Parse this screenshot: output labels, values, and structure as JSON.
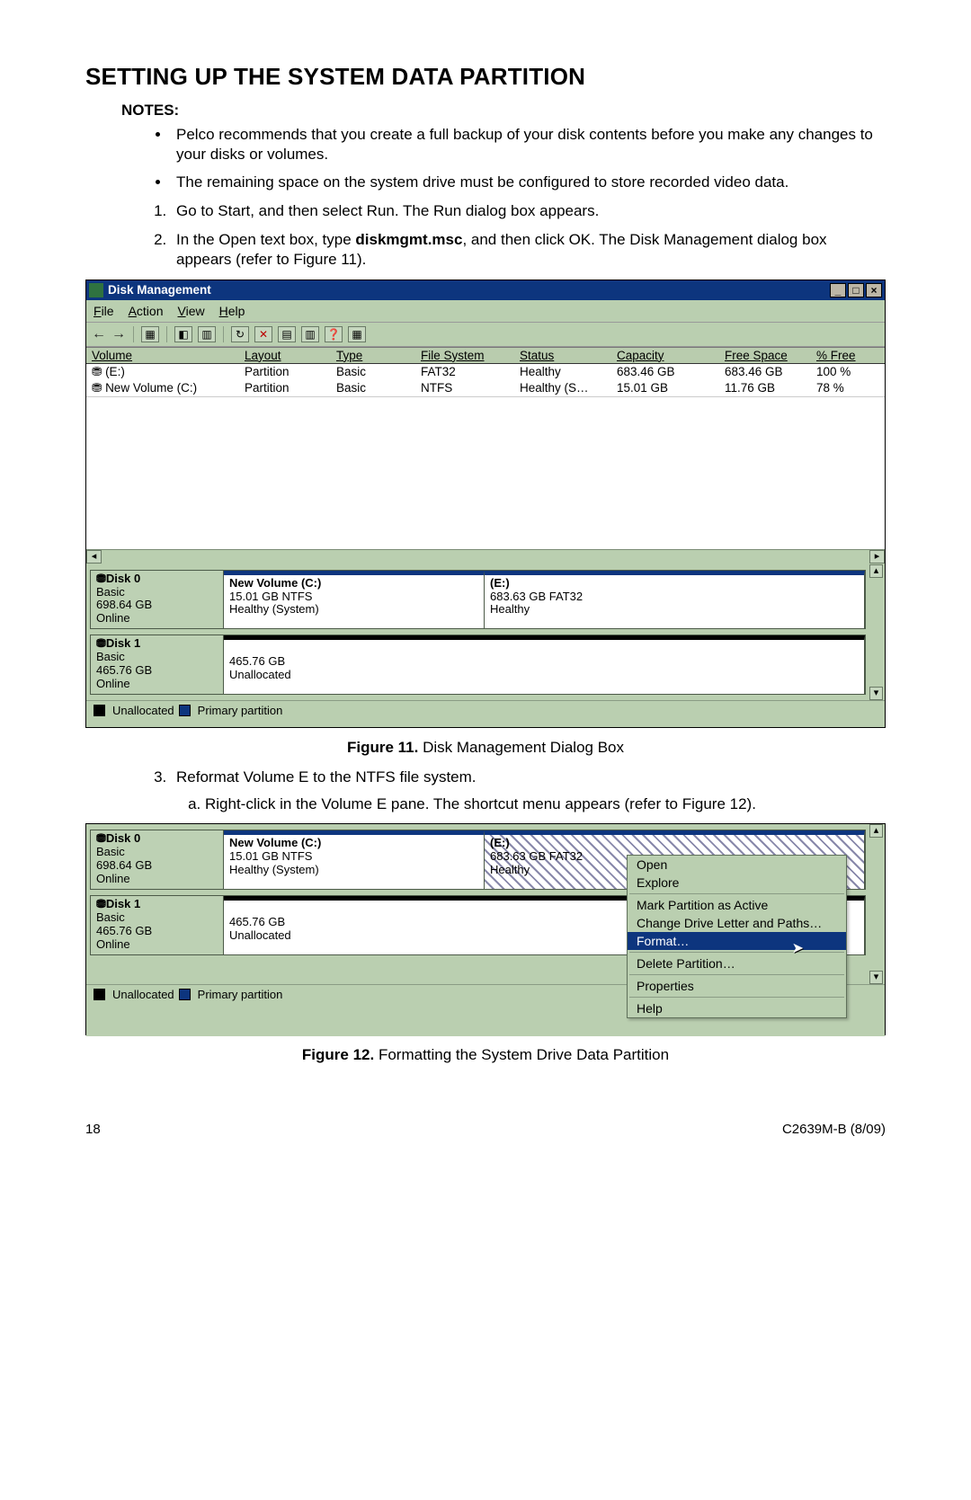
{
  "title": "SETTING UP THE SYSTEM DATA PARTITION",
  "notes_heading": "NOTES:",
  "notes": [
    "Pelco recommends that you create a full backup of your disk contents before you make any changes to your disks or volumes.",
    "The remaining space on the system drive must be configured to store recorded video data."
  ],
  "steps": {
    "s1": "Go to Start, and then select Run. The Run dialog box appears.",
    "s2_a": "In the Open text box, type ",
    "s2_b": "diskmgmt.msc",
    "s2_c": ", and then click OK. The Disk Management dialog box appears (refer to Figure 11).",
    "s3": "Reformat Volume E to the NTFS file system.",
    "s3a": "Right-click in the Volume E pane. The shortcut menu appears (refer to Figure 12)."
  },
  "captions": {
    "fig11_b": "Figure 11.",
    "fig11_t": "  Disk Management Dialog Box",
    "fig12_b": "Figure 12.",
    "fig12_t": "  Formatting the System Drive Data Partition"
  },
  "dm": {
    "title": "Disk Management",
    "menu": {
      "file": "File",
      "action": "Action",
      "view": "View",
      "help": "Help"
    },
    "headers": {
      "volume": "Volume",
      "layout": "Layout",
      "type": "Type",
      "fs": "File System",
      "status": "Status",
      "cap": "Capacity",
      "free": "Free Space",
      "pfree": "% Free"
    },
    "rows": [
      {
        "volume": "(E:)",
        "layout": "Partition",
        "type": "Basic",
        "fs": "FAT32",
        "status": "Healthy",
        "cap": "683.46 GB",
        "free": "683.46 GB",
        "pfree": "100 %"
      },
      {
        "volume": "New Volume (C:)",
        "layout": "Partition",
        "type": "Basic",
        "fs": "NTFS",
        "status": "Healthy (S…",
        "cap": "15.01 GB",
        "free": "11.76 GB",
        "pfree": "78 %"
      }
    ],
    "disk0": {
      "name": "Disk 0",
      "type": "Basic",
      "size": "698.64 GB",
      "state": "Online",
      "p1": {
        "name": "New Volume  (C:)",
        "line2": "15.01 GB NTFS",
        "line3": "Healthy (System)"
      },
      "p2": {
        "name": "(E:)",
        "line2": "683.63 GB FAT32",
        "line3": "Healthy"
      }
    },
    "disk1": {
      "name": "Disk 1",
      "type": "Basic",
      "size": "465.76 GB",
      "state": "Online",
      "p1": {
        "line2": "465.76 GB",
        "line3": "Unallocated"
      }
    },
    "legend": {
      "unalloc": "Unallocated",
      "primary": "Primary partition"
    }
  },
  "ctx": {
    "open": "Open",
    "explore": "Explore",
    "mark_active": "Mark Partition as Active",
    "change_letter": "Change Drive Letter and Paths…",
    "format": "Format…",
    "delete": "Delete Partition…",
    "properties": "Properties",
    "help": "Help"
  },
  "footer": {
    "page": "18",
    "doc": "C2639M-B (8/09)"
  }
}
